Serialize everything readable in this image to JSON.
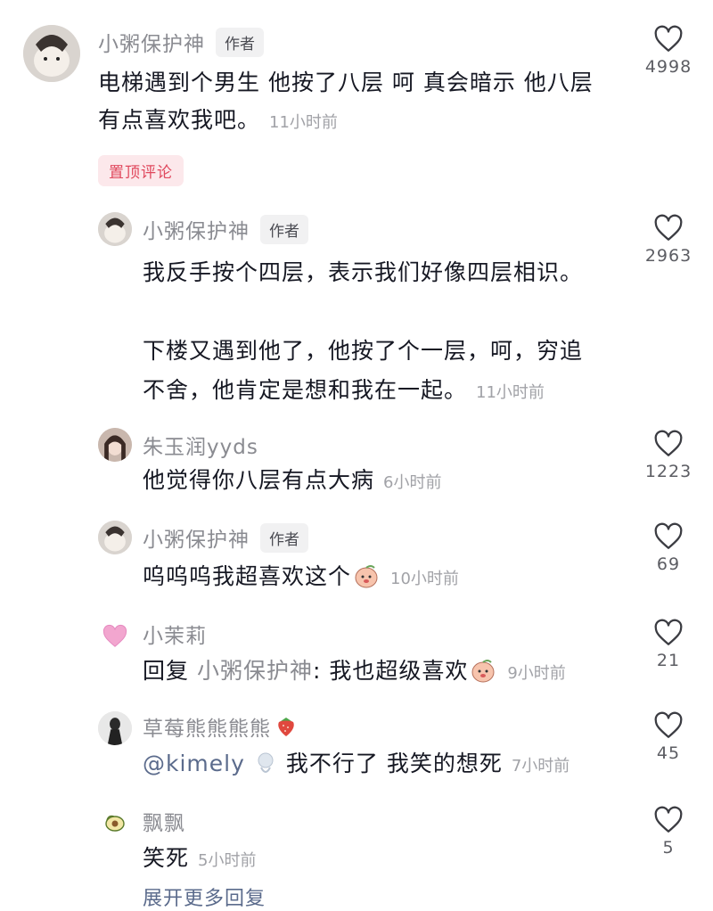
{
  "comments": [
    {
      "username": "小粥保护神",
      "tag": "作者",
      "text_lines": [
        "电梯遇到个男生 他按了八层 呵 真会暗示 他八层",
        "有点喜欢我吧。"
      ],
      "time": "11小时前",
      "likes": "4998",
      "pinned_label": "置顶评论"
    },
    {
      "username": "小粥保护神",
      "tag": "作者",
      "text_lines": [
        "我反手按个四层，表示我们好像四层相识。",
        "",
        "下楼又遇到他了，他按了个一层，呵，穷追",
        "不舍，他肯定是想和我在一起。"
      ],
      "time": "11小时前",
      "likes": "2963"
    },
    {
      "username": "朱玉润yyds",
      "text": "他觉得你八层有点大病",
      "time": "6小时前",
      "likes": "1223"
    },
    {
      "username": "小粥保护神",
      "tag": "作者",
      "text": "呜呜呜我超喜欢这个",
      "time": "10小时前",
      "likes": "69"
    },
    {
      "username": "小茉莉",
      "reply_prefix": "回复",
      "reply_to": "小粥保护神",
      "text": ": 我也超级喜欢",
      "time": "9小时前",
      "likes": "21"
    },
    {
      "username": "草莓熊熊熊熊",
      "mention": "@kimely",
      "text": "我不行了 我笑的想死",
      "time": "7小时前",
      "likes": "45"
    },
    {
      "username": "飘飘",
      "text": "笑死",
      "time": "5小时前",
      "likes": "5"
    }
  ],
  "more_replies": "展开更多回复",
  "icons": {
    "like": "heart-outline-icon",
    "emoji": "peach-emoji-icon"
  },
  "colors": {
    "username": "#8a8b91",
    "pin_badge_bg": "#fce8eb",
    "pin_badge_text": "#e0485d",
    "mention": "#5b6b8c"
  }
}
